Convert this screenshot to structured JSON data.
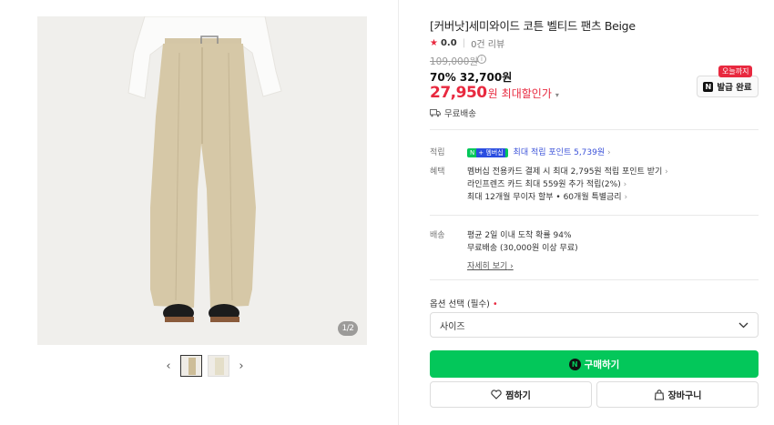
{
  "gallery": {
    "page_indicator": "1/2",
    "prev_arrow": "‹",
    "next_arrow": "›"
  },
  "product": {
    "title": "[커버낫]세미와이드 코튼 벨티드 팬츠 Beige",
    "rating": "0.0",
    "reviews": "0건 리뷰",
    "original_price": "109,000원",
    "discount_line": "70% 32,700원",
    "final_price": "27,950",
    "final_price_unit": "원",
    "max_discount_label": "최대할인가",
    "shipping_short": "무료배송"
  },
  "coupon": {
    "tag": "오늘까지",
    "n_mark": "N",
    "label": "발급 완료"
  },
  "benefits": {
    "points_label": "적립",
    "npay_badge": "N",
    "npay_plus": "+ 멤버십",
    "points_text": "최대 적립 포인트 5,739원",
    "benefit_label": "혜택",
    "benefit_lines": [
      "멤버십 전용카드 결제 시 최대 2,795원 적립 포인트 받기",
      "라인프렌즈 카드 최대 559원 추가 적립(2%)",
      "최대 12개월 무이자 할부 • 60개월 특별금리"
    ]
  },
  "delivery": {
    "label": "배송",
    "line1": "평균 2일 이내 도착 확률 94%",
    "line2": "무료배송 (30,000원 이상 무료)",
    "detail_link": "자세히 보기"
  },
  "options": {
    "label": "옵션 선택 (필수)",
    "required_mark": "•",
    "select_value": "사이즈"
  },
  "actions": {
    "buy_mark": "N",
    "buy_label": "구매하기",
    "wish_label": "찜하기",
    "cart_label": "장바구니"
  },
  "colors": {
    "accent_red": "#e8293f",
    "naver_green": "#03c75a",
    "link_blue": "#3b52d9"
  }
}
